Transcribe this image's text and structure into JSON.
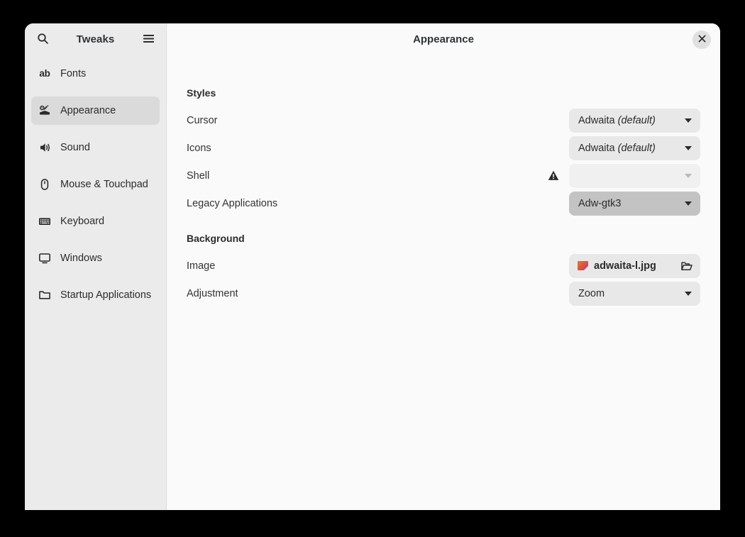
{
  "window": {
    "sidebar_title": "Tweaks",
    "main_title": "Appearance",
    "search_icon": "search-icon",
    "menu_icon": "hamburger-menu-icon",
    "close_icon": "close-icon"
  },
  "sidebar": {
    "items": [
      {
        "label": "Fonts",
        "icon": "ab-text-icon",
        "selected": false
      },
      {
        "label": "Appearance",
        "icon": "theme-icon",
        "selected": true
      },
      {
        "label": "Sound",
        "icon": "speaker-icon",
        "selected": false
      },
      {
        "label": "Mouse & Touchpad",
        "icon": "mouse-icon",
        "selected": false
      },
      {
        "label": "Keyboard",
        "icon": "keyboard-icon",
        "selected": false
      },
      {
        "label": "Windows",
        "icon": "window-icon",
        "selected": false
      },
      {
        "label": "Startup Applications",
        "icon": "folder-icon",
        "selected": false
      }
    ]
  },
  "content": {
    "styles": {
      "title": "Styles",
      "cursor": {
        "label": "Cursor",
        "value": "Adwaita",
        "value_suffix": "(default)"
      },
      "icons": {
        "label": "Icons",
        "value": "Adwaita",
        "value_suffix": "(default)"
      },
      "shell": {
        "label": "Shell",
        "value": "",
        "warning_icon": "warning-triangle-icon"
      },
      "legacy": {
        "label": "Legacy Applications",
        "value": "Adw-gtk3"
      }
    },
    "background": {
      "title": "Background",
      "image": {
        "label": "Image",
        "value": "adwaita-l.jpg",
        "browse_icon": "folder-open-icon"
      },
      "adjustment": {
        "label": "Adjustment",
        "value": "Zoom"
      }
    }
  },
  "colors": {
    "page_background": "#000000",
    "window_background": "#fafafa",
    "sidebar_background": "#ebebeb",
    "selected_row": "#dadada",
    "control_background": "#e8e8e8",
    "control_active": "#c3c3c3",
    "control_disabled": "#f0f0f0",
    "text_primary": "#2b2b2b"
  }
}
